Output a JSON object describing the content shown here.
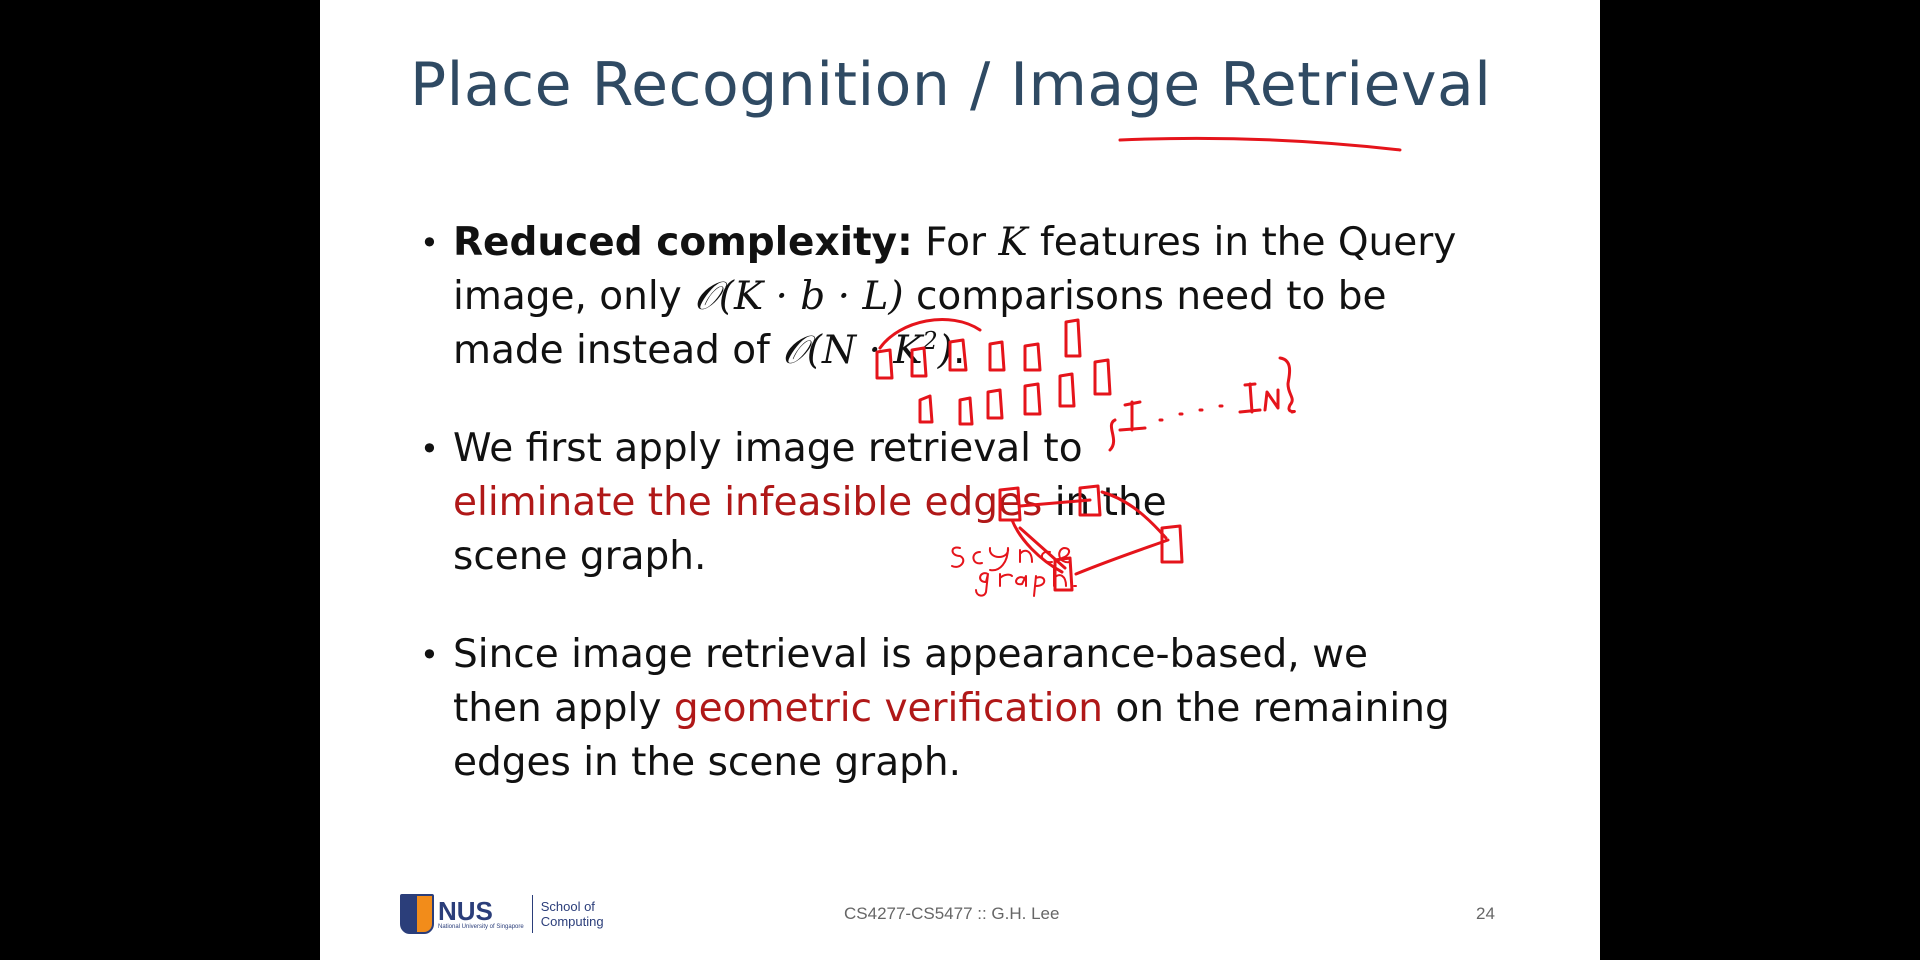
{
  "slide": {
    "title": "Place Recognition / Image Retrieval",
    "bullets": [
      {
        "bold": "Reduced complexity:",
        "t1": " For ",
        "m1": "K",
        "t2": " features in the Query image, only ",
        "m2": "𝒪(K · b · L)",
        "t3": " comparisons need to be made instead of ",
        "m3": "𝒪(N · K",
        "m3sup": "2",
        "m3end": ")",
        "t4": "."
      },
      {
        "t1": "We first apply image retrieval to ",
        "red": "eliminate the infeasible edges",
        "t2": " in the scene graph."
      },
      {
        "t1": "Since image retrieval is appearance-based, we then apply ",
        "red": "geometric verification",
        "t2": " on the remaining edges in the scene graph."
      }
    ],
    "footer": {
      "logo_main": "NUS",
      "logo_sub": "National University of Singapore",
      "school": "School of Computing",
      "course": "CS4277-CS5477 :: G.H. Lee",
      "page": "24"
    },
    "annotation": {
      "handwritten_label": "Scence graph.",
      "handwritten_seq": "{I₁ . . . . I_N}"
    },
    "colors": {
      "title": "#2f4a63",
      "highlight": "#b01818",
      "ink": "#e5141b",
      "background": "#000000"
    }
  }
}
